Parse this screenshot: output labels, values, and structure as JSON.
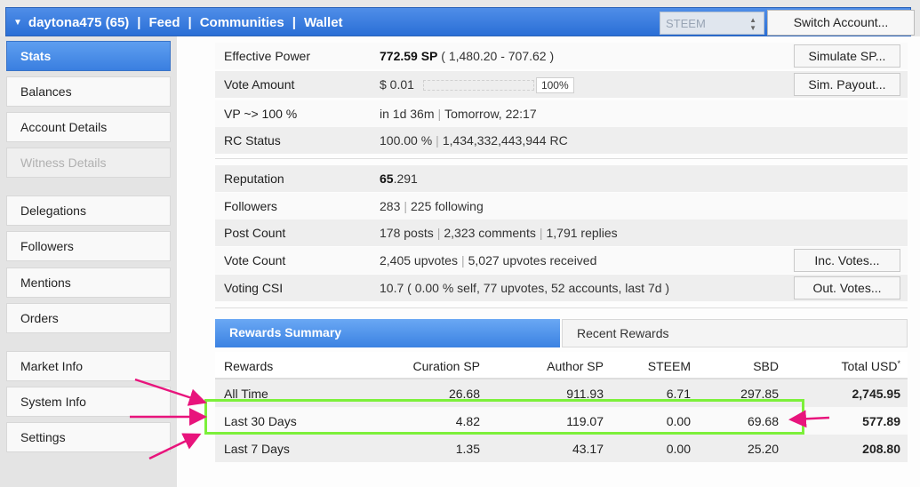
{
  "header": {
    "account": "daytona475 (65)",
    "nav": [
      "Feed",
      "Communities",
      "Wallet"
    ],
    "chain": "STEEM",
    "switch_account": "Switch Account..."
  },
  "sidebar": {
    "items": [
      {
        "label": "Stats"
      },
      {
        "label": "Balances"
      },
      {
        "label": "Account Details"
      },
      {
        "label": "Witness Details"
      },
      {
        "label": "Delegations"
      },
      {
        "label": "Followers"
      },
      {
        "label": "Mentions"
      },
      {
        "label": "Orders"
      },
      {
        "label": "Market Info"
      },
      {
        "label": "System Info"
      },
      {
        "label": "Settings"
      }
    ]
  },
  "stats": {
    "effective_power": {
      "label": "Effective Power",
      "value": "772.59 SP",
      "detail": "( 1,480.20 - 707.62 )",
      "button": "Simulate SP..."
    },
    "vote_amount": {
      "label": "Vote Amount",
      "value": "$ 0.01",
      "percent": "100%",
      "button": "Sim. Payout..."
    },
    "vp": {
      "label": "VP ~> 100 %",
      "value": "in 1d 36m",
      "detail": "Tomorrow, 22:17"
    },
    "rc": {
      "label": "RC Status",
      "value": "100.00 %",
      "detail": "1,434,332,443,944 RC"
    },
    "reputation": {
      "label": "Reputation",
      "value_main": "65",
      "value_frac": ".291"
    },
    "followers": {
      "label": "Followers",
      "value": "283",
      "detail": "225 following"
    },
    "post_count": {
      "label": "Post Count",
      "posts": "178 posts",
      "comments": "2,323 comments",
      "replies": "1,791 replies"
    },
    "vote_count": {
      "label": "Vote Count",
      "value": "2,405 upvotes",
      "detail": "5,027 upvotes received",
      "button": "Inc. Votes..."
    },
    "voting_csi": {
      "label": "Voting CSI",
      "value": "10.7 ( 0.00 % self, 77 upvotes, 52 accounts, last 7d )",
      "button": "Out. Votes..."
    }
  },
  "rewards": {
    "tabs": [
      "Rewards Summary",
      "Recent Rewards"
    ],
    "columns": [
      "Rewards",
      "Curation SP",
      "Author SP",
      "STEEM",
      "SBD",
      "Total USD"
    ],
    "total_marker": "*",
    "rows": [
      {
        "name": "All Time",
        "cells": [
          "26.68",
          "911.93",
          "6.71",
          "297.85",
          "2,745.95"
        ]
      },
      {
        "name": "Last 30 Days",
        "cells": [
          "4.82",
          "119.07",
          "0.00",
          "69.68",
          "577.89"
        ]
      },
      {
        "name": "Last 7 Days",
        "cells": [
          "1.35",
          "43.17",
          "0.00",
          "25.20",
          "208.80"
        ]
      }
    ]
  },
  "annotation": {
    "highlight_color": "#7cf03a",
    "arrow_color": "#e8147c"
  }
}
